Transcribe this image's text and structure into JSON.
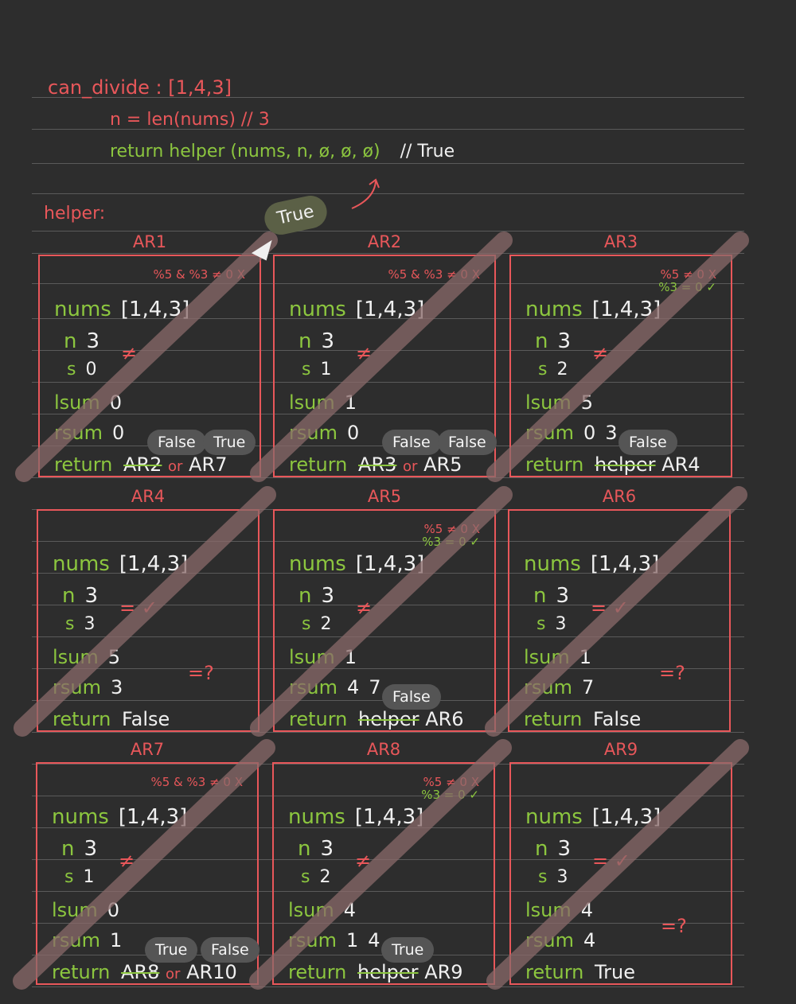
{
  "header": {
    "line1": "can_divide : [1,4,3]",
    "line2": "n = len(nums) // 3",
    "line3_fn": "return helper (nums, n, ø, ø, ø)",
    "line3_comment": "// True"
  },
  "helper_label": "helper:",
  "big_true": "True",
  "panels": [
    {
      "title": "AR1",
      "anno1": "%5 & %3 ≠ 0 X",
      "anno2": "",
      "nums": "[1,4,3]",
      "n": "3",
      "s": "0",
      "lsum": "0",
      "rsum": "0",
      "rsum_new": "",
      "cmp": "≠",
      "ret_a": "AR2",
      "ret_or": "or",
      "ret_b": "AR7",
      "pill1": "False",
      "pill2": "True"
    },
    {
      "title": "AR2",
      "anno1": "%5 & %3 ≠ 0 X",
      "anno2": "",
      "nums": "[1,4,3]",
      "n": "3",
      "s": "1",
      "lsum": "1",
      "rsum": "0",
      "rsum_new": "",
      "cmp": "≠",
      "ret_a": "AR3",
      "ret_or": "or",
      "ret_b": "AR5",
      "pill1": "False",
      "pill2": "False"
    },
    {
      "title": "AR3",
      "anno1": "%5 ≠ 0 X",
      "anno2": "%3 = 0 ✓",
      "nums": "[1,4,3]",
      "n": "3",
      "s": "2",
      "lsum": "5",
      "rsum": "0",
      "rsum_new": "3",
      "cmp": "≠",
      "ret_a": "helper",
      "ret_or": "",
      "ret_b": "AR4",
      "pill1": "False",
      "pill2": ""
    },
    {
      "title": "AR4",
      "anno1": "",
      "anno2": "",
      "nums": "[1,4,3]",
      "n": "3",
      "s": "3",
      "lsum": "5",
      "rsum": "3",
      "rsum_new": "",
      "cmp": "= ✓",
      "ret_a": "",
      "ret_or": "",
      "ret_b": "False",
      "pill1": "",
      "pill2": "",
      "q": "=?"
    },
    {
      "title": "AR5",
      "anno1": "%5 ≠ 0 X",
      "anno2": "%3 = 0 ✓",
      "nums": "[1,4,3]",
      "n": "3",
      "s": "2",
      "lsum": "1",
      "rsum": "4",
      "rsum_new": "7",
      "cmp": "≠",
      "ret_a": "helper",
      "ret_or": "",
      "ret_b": "AR6",
      "pill1": "False",
      "pill2": ""
    },
    {
      "title": "AR6",
      "anno1": "",
      "anno2": "",
      "nums": "[1,4,3]",
      "n": "3",
      "s": "3",
      "lsum": "1",
      "rsum": "7",
      "rsum_new": "",
      "cmp": "= ✓",
      "ret_a": "",
      "ret_or": "",
      "ret_b": "False",
      "pill1": "",
      "pill2": "",
      "q": "=?"
    },
    {
      "title": "AR7",
      "anno1": "%5 & %3 ≠ 0 X",
      "anno2": "",
      "nums": "[1,4,3]",
      "n": "3",
      "s": "1",
      "lsum": "0",
      "rsum": "1",
      "rsum_new": "",
      "cmp": "≠",
      "ret_a": "AR8",
      "ret_or": "or",
      "ret_b": "AR10",
      "pill1": "True",
      "pill2": "False"
    },
    {
      "title": "AR8",
      "anno1": "%5 ≠ 0 X",
      "anno2": "%3 = 0 ✓",
      "nums": "[1,4,3]",
      "n": "3",
      "s": "2",
      "lsum": "4",
      "rsum": "1",
      "rsum_new": "4",
      "cmp": "≠",
      "ret_a": "helper",
      "ret_or": "",
      "ret_b": "AR9",
      "pill1": "True",
      "pill2": ""
    },
    {
      "title": "AR9",
      "anno1": "",
      "anno2": "",
      "nums": "[1,4,3]",
      "n": "3",
      "s": "3",
      "lsum": "4",
      "rsum": "4",
      "rsum_new": "",
      "cmp": "= ✓",
      "ret_a": "",
      "ret_or": "",
      "ret_b": "True",
      "pill1": "",
      "pill2": "",
      "q": "=?"
    }
  ],
  "labels": {
    "nums": "nums",
    "n": "n",
    "s": "s",
    "lsum": "lsum",
    "rsum": "rsum",
    "ret": "return"
  },
  "colors": {
    "background": "#2d2d2d",
    "red": "#e8575a",
    "green": "#8cc63f",
    "text": "#f0f0f0",
    "pill": "#555555",
    "strike": "#8a6a6a"
  }
}
